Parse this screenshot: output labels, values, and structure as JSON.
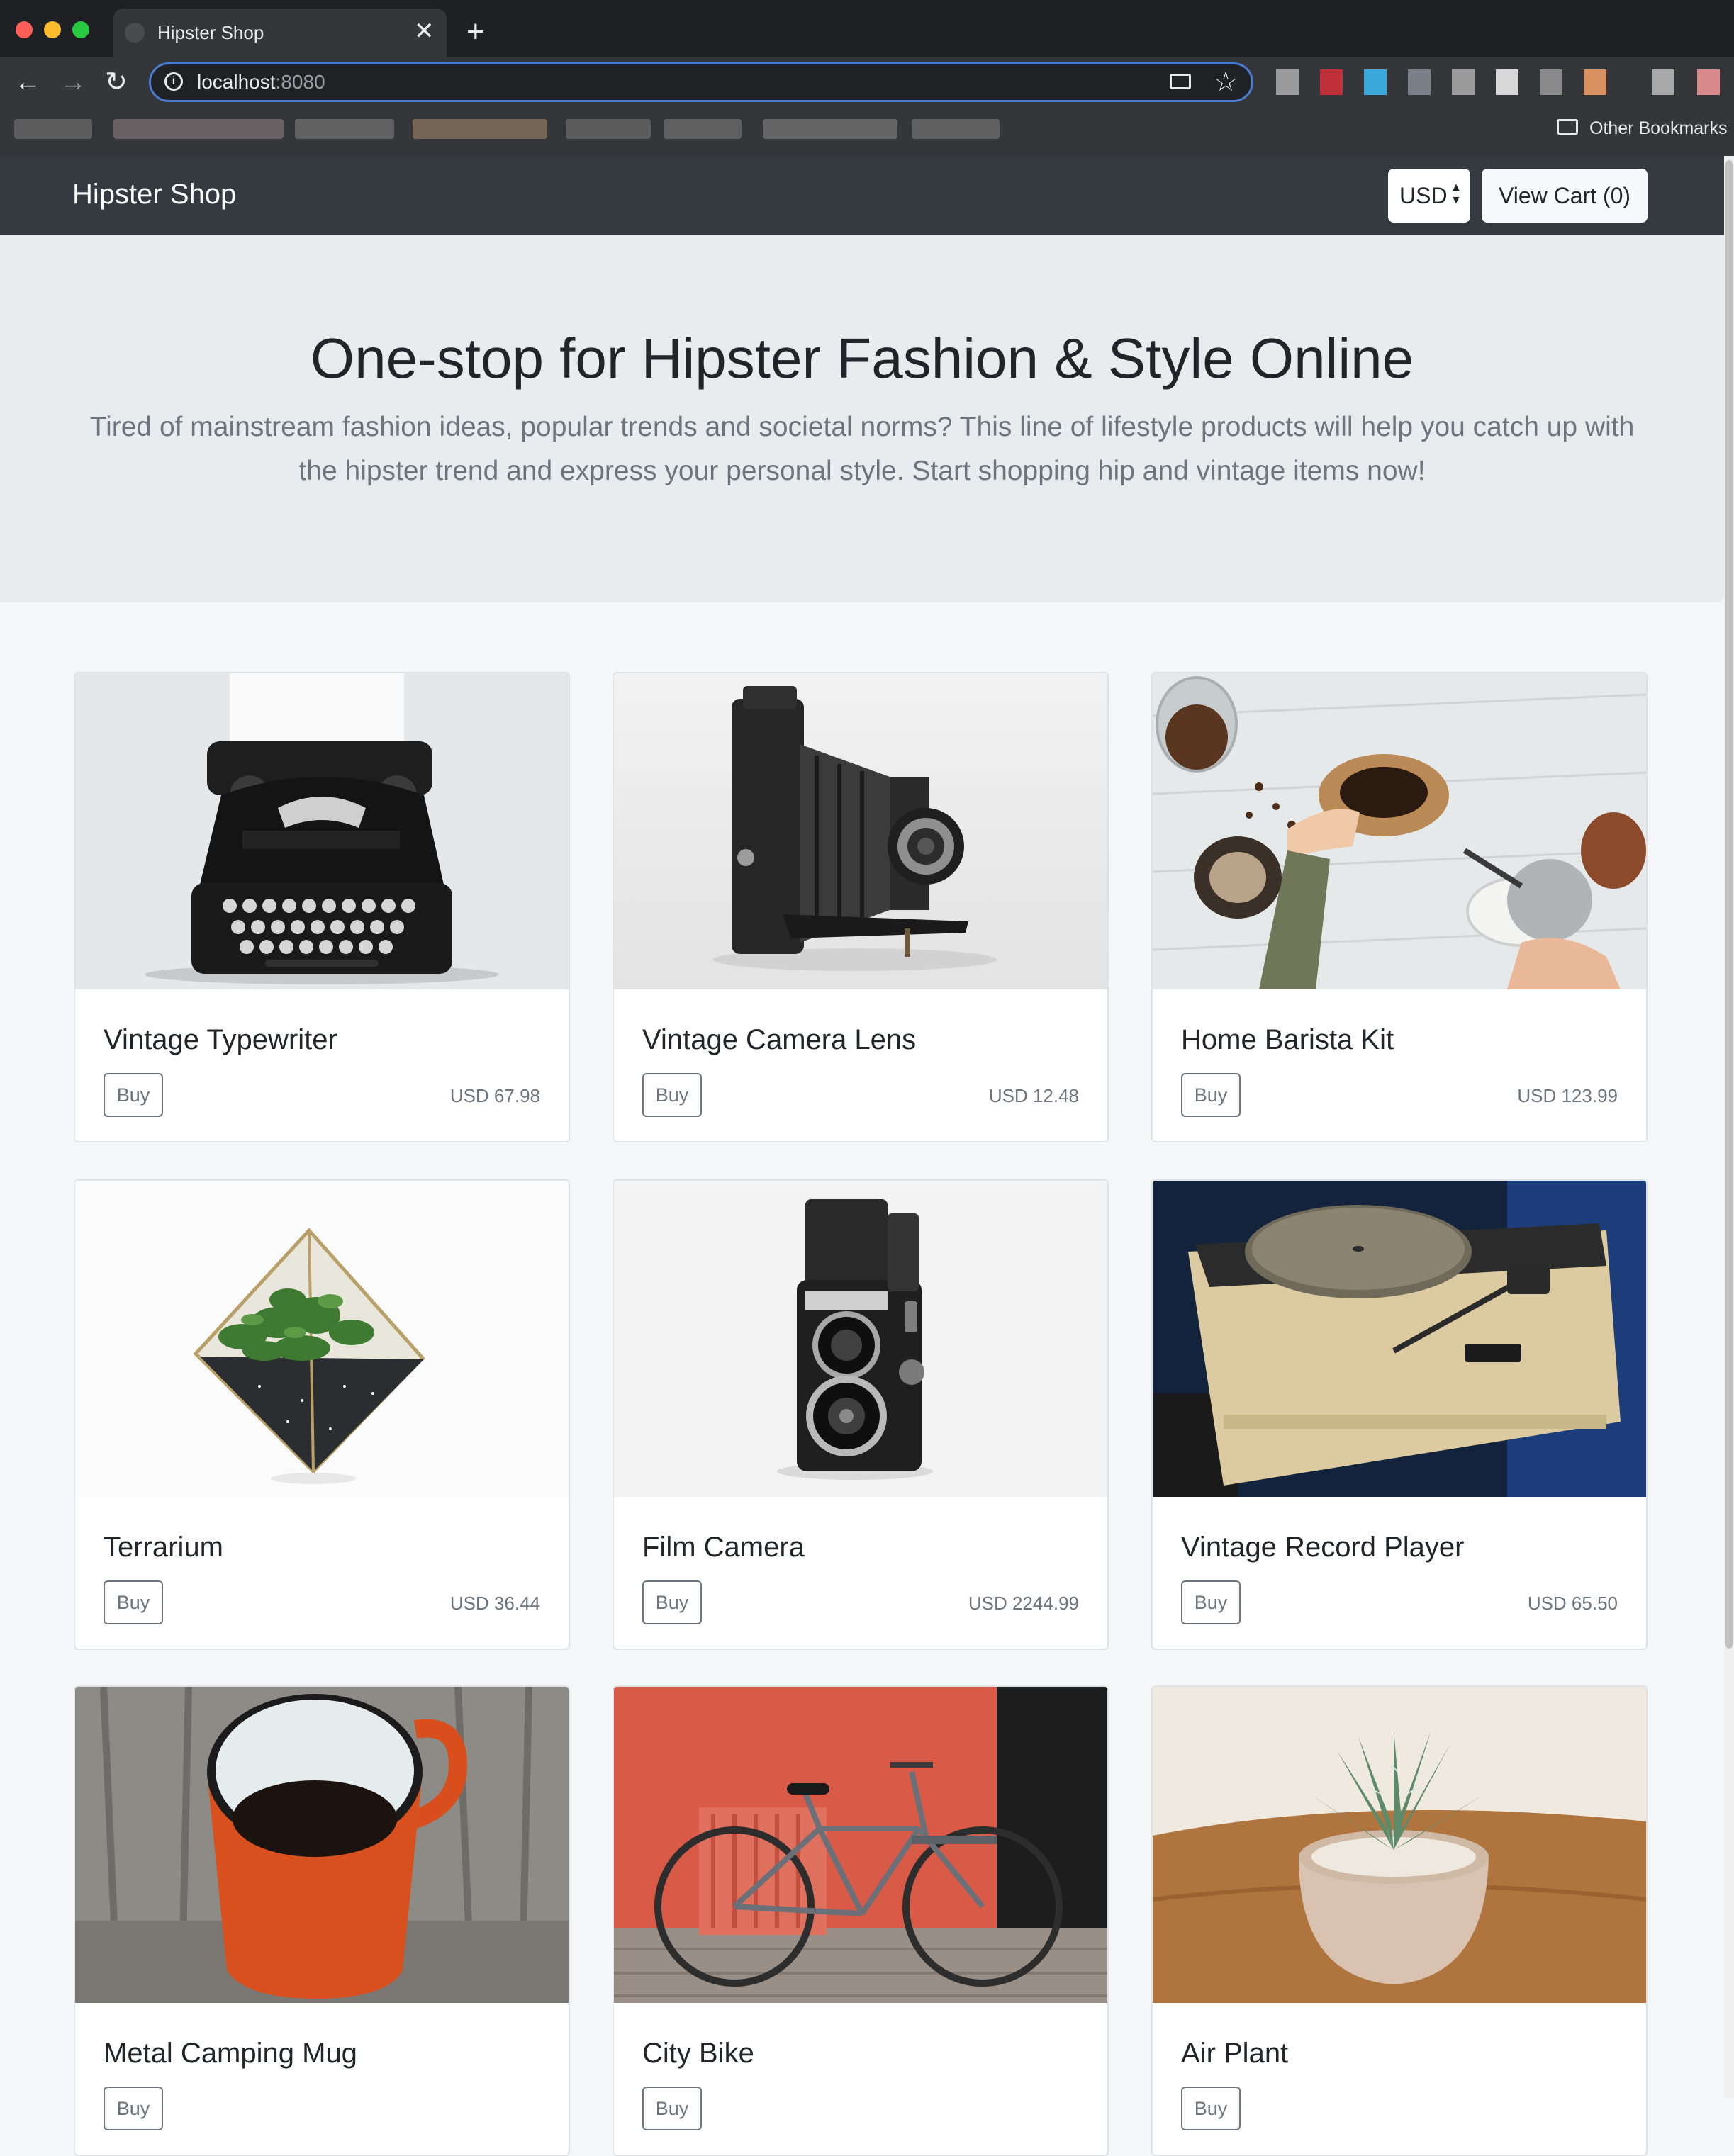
{
  "browser": {
    "tab_title": "Hipster Shop",
    "tab_close": "✕",
    "new_tab": "+",
    "url_host": "localhost",
    "url_port": ":8080",
    "other_bookmarks": "Other Bookmarks",
    "icons": [
      "back-icon",
      "forward-icon",
      "reload-icon",
      "info-icon",
      "cast-icon",
      "star-icon",
      "folder-icon"
    ]
  },
  "header": {
    "brand": "Hipster Shop",
    "currency": "USD",
    "cart_button": "View Cart (0)"
  },
  "hero": {
    "title": "One-stop for Hipster Fashion & Style Online",
    "lead": "Tired of mainstream fashion ideas, popular trends and societal norms? This line of lifestyle products will help you catch up with the hipster trend and express your personal style. Start shopping hip and vintage items now!"
  },
  "buy_label": "Buy",
  "products": [
    {
      "name": "Vintage Typewriter",
      "price": "USD 67.98"
    },
    {
      "name": "Vintage Camera Lens",
      "price": "USD 12.48"
    },
    {
      "name": "Home Barista Kit",
      "price": "USD 123.99"
    },
    {
      "name": "Terrarium",
      "price": "USD 36.44"
    },
    {
      "name": "Film Camera",
      "price": "USD 2244.99"
    },
    {
      "name": "Vintage Record Player",
      "price": "USD 65.50"
    },
    {
      "name": "Metal Camping Mug"
    },
    {
      "name": "City Bike"
    },
    {
      "name": "Air Plant"
    }
  ],
  "colors": {
    "navbar": "#343a40",
    "hero_bg": "#e9ecef",
    "page_bg": "#f5f6f7",
    "muted": "#6c757d"
  }
}
